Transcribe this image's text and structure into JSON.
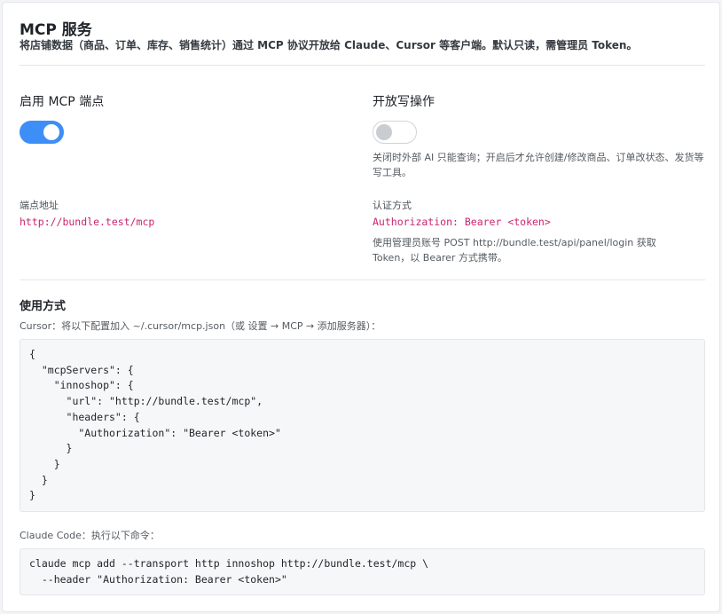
{
  "header": {
    "title": "MCP 服务",
    "subtitle": "将店铺数据（商品、订单、库存、销售统计）通过 MCP 协议开放给 Claude、Cursor 等客户端。默认只读，需管理员 Token。"
  },
  "endpoint": {
    "label": "启用 MCP 端点",
    "enabled": true,
    "address_label": "端点地址",
    "address_value": "http://bundle.test/mcp"
  },
  "write_ops": {
    "label": "开放写操作",
    "enabled": false,
    "help": "关闭时外部 AI 只能查询；开启后才允许创建/修改商品、订单改状态、发货等写工具。"
  },
  "auth": {
    "label": "认证方式",
    "value": "Authorization: Bearer <token>",
    "help": "使用管理员账号 POST http://bundle.test/api/panel/login 获取 Token，以 Bearer 方式携带。"
  },
  "usage": {
    "heading": "使用方式",
    "cursor_caption": "Cursor：将以下配置加入 ~/.cursor/mcp.json（或 设置 → MCP → 添加服务器）：",
    "cursor_code": "{\n  \"mcpServers\": {\n    \"innoshop\": {\n      \"url\": \"http://bundle.test/mcp\",\n      \"headers\": {\n        \"Authorization\": \"Bearer <token>\"\n      }\n    }\n  }\n}",
    "claude_caption": "Claude Code：执行以下命令：",
    "claude_code": "claude mcp add --transport http innoshop http://bundle.test/mcp \\\n  --header \"Authorization: Bearer <token>\""
  },
  "colors": {
    "toggle_on": "#3e8ef7",
    "code_accent": "#c8246f"
  }
}
